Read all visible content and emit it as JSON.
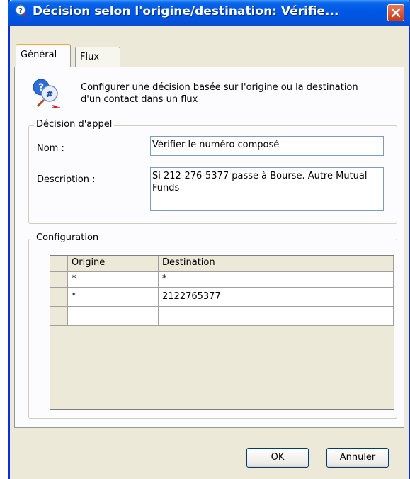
{
  "window": {
    "title": "Décision selon l'origine/destination: Vérifie...",
    "close_symbol": "close-icon"
  },
  "tabs": [
    {
      "label": "Général",
      "active": true
    },
    {
      "label": "Flux",
      "active": false
    }
  ],
  "intro": {
    "text": "Configurer une décision basée sur l'origine ou la destination d'un contact dans un flux",
    "icon": "help-question-icon"
  },
  "decision_group": {
    "legend": "Décision d'appel",
    "name_label": "Nom :",
    "name_value": "Vérifier le numéro composé",
    "description_label": "Description :",
    "description_value": "Si 212-276-5377 passe à Bourse. Autre Mutual Funds"
  },
  "config_group": {
    "legend": "Configuration",
    "columns": [
      "Origine",
      "Destination"
    ],
    "rows": [
      [
        "*",
        "*"
      ],
      [
        "*",
        "2122765377"
      ],
      [
        "",
        ""
      ]
    ]
  },
  "buttons": {
    "ok": "OK",
    "cancel": "Annuler"
  },
  "colors": {
    "titlebar": "#0058e6",
    "face": "#ece9d8",
    "panel": "#fcfcfe",
    "tab_highlight": "#f7a83b",
    "close": "#c73b1c"
  }
}
